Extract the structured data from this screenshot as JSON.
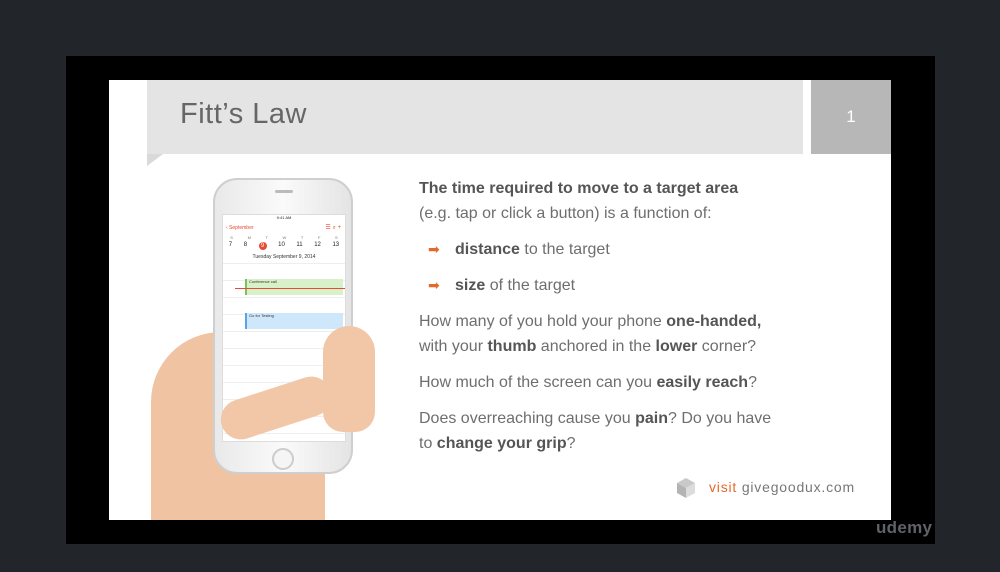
{
  "slide": {
    "title": "Fitt’s Law",
    "page_number": "1"
  },
  "phone": {
    "status_time": "9:41 AM",
    "status_battery": "100%",
    "calendar_back": "September",
    "week_letters": [
      "S",
      "M",
      "T",
      "W",
      "T",
      "F",
      "S"
    ],
    "week_days": [
      "7",
      "8",
      "9",
      "10",
      "11",
      "12",
      "13"
    ],
    "selected_day": "9",
    "selected_date": "Tuesday  September 9, 2014",
    "event_1": "Conference call",
    "event_2": "Go for Testing"
  },
  "content": {
    "intro_bold": "The time required to move to a target area",
    "intro_rest": "(e.g. tap or click a button) is a function of:",
    "bullet_1_bold": "distance",
    "bullet_1_rest": " to the target",
    "bullet_2_bold": "size",
    "bullet_2_rest": " of the target",
    "q1_a": "How many of you hold your phone ",
    "q1_b": "one-handed,",
    "q1_c": "with your ",
    "q1_d": "thumb",
    "q1_e": " anchored in the ",
    "q1_f": "lower",
    "q1_g": " corner?",
    "q2_a": "How much of the screen can you ",
    "q2_b": "easily reach",
    "q2_c": "?",
    "q3_a": "Does overreaching cause you ",
    "q3_b": "pain",
    "q3_c": "? Do you have",
    "q3_d": "to ",
    "q3_e": "change your grip",
    "q3_f": "?"
  },
  "logo": {
    "visit": "visit",
    "site": " givegoodux.com"
  },
  "watermark": "udemy",
  "colors": {
    "accent": "#e26a2c",
    "calendar_red": "#e94a35"
  }
}
